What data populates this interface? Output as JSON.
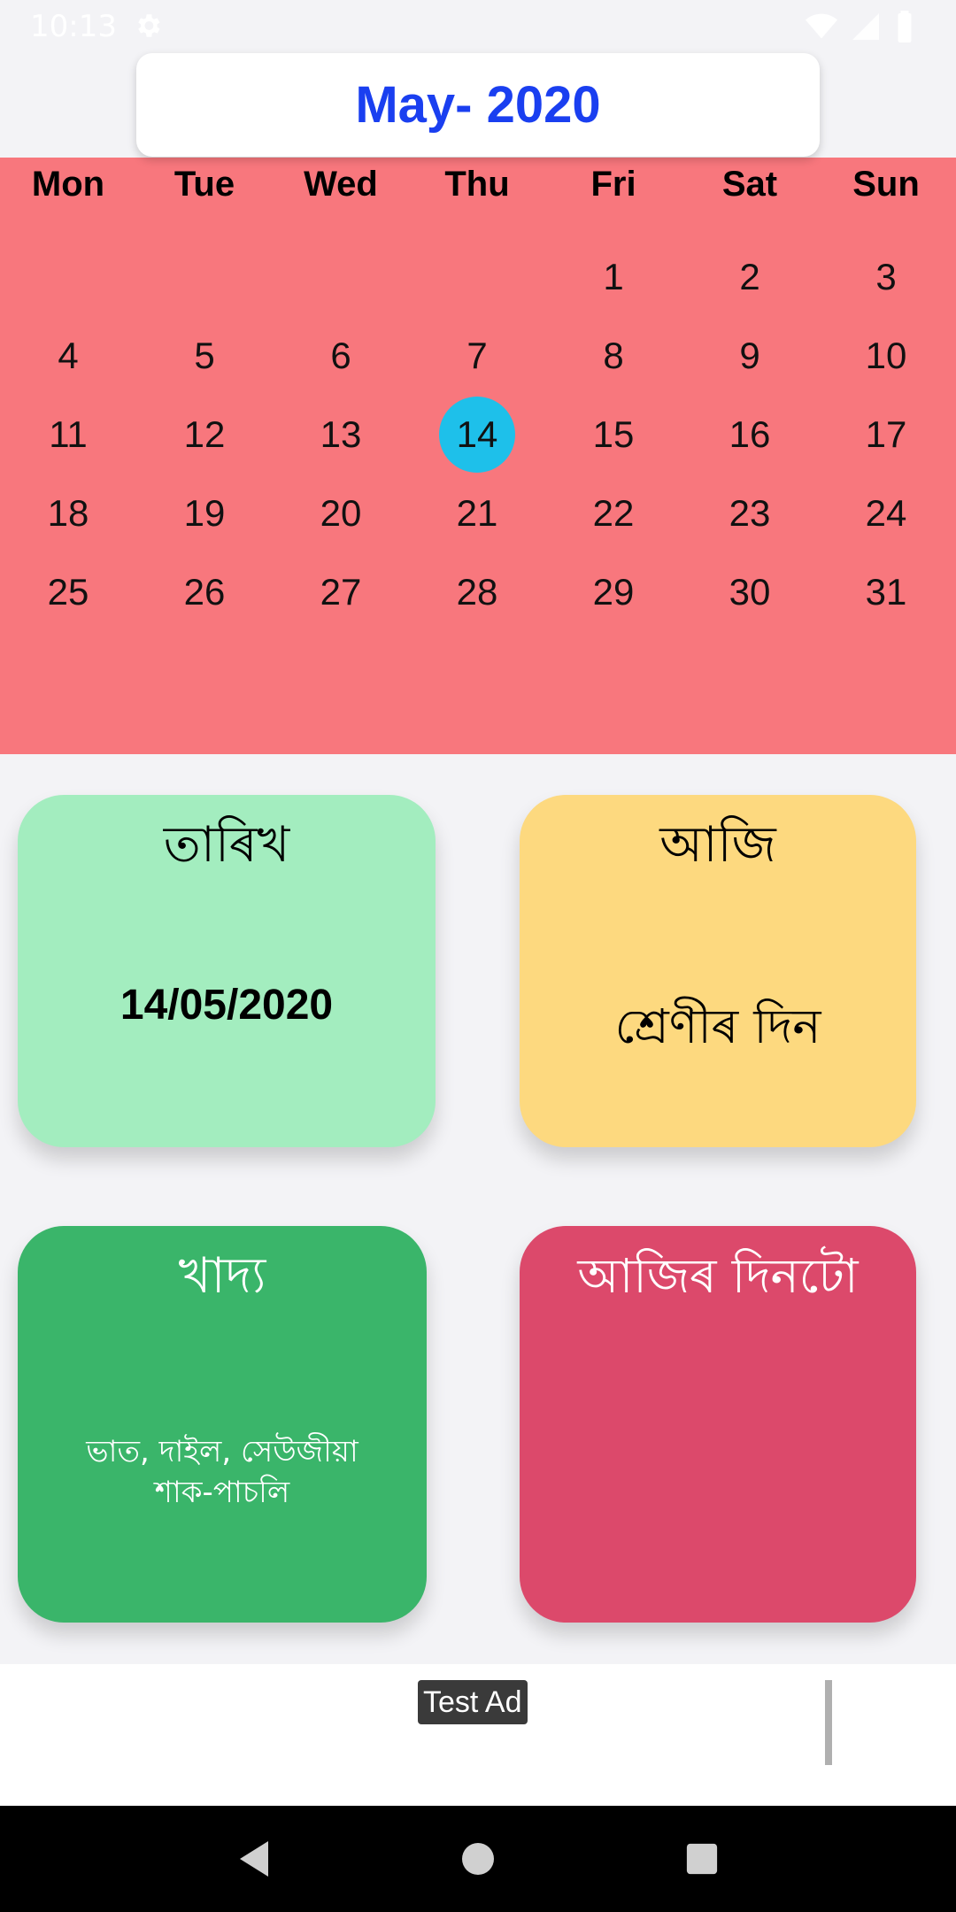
{
  "status_bar": {
    "time": "10:13",
    "icons": [
      "settings-gear-icon",
      "wifi-icon",
      "signal-icon",
      "battery-icon"
    ]
  },
  "header": {
    "month_title": "May- 2020"
  },
  "calendar": {
    "weekdays": [
      "Mon",
      "Tue",
      "Wed",
      "Thu",
      "Fri",
      "Sat",
      "Sun"
    ],
    "days": [
      "",
      "",
      "",
      "",
      "1",
      "2",
      "3",
      "4",
      "5",
      "6",
      "7",
      "8",
      "9",
      "10",
      "11",
      "12",
      "13",
      "14",
      "15",
      "16",
      "17",
      "18",
      "19",
      "20",
      "21",
      "22",
      "23",
      "24",
      "25",
      "26",
      "27",
      "28",
      "29",
      "30",
      "31"
    ],
    "selected_day": "14"
  },
  "cards": {
    "date": {
      "title": "তাৰিখ",
      "value": "14/05/2020"
    },
    "today": {
      "title": "আজি",
      "value": "শ্ৰেণীৰ দিন"
    },
    "food": {
      "title": "খাদ্য",
      "value": "ভাত, দাইল, সেউজীয়া শাক-পাচলি"
    },
    "day_type": {
      "title": "আজিৰ দিনটো"
    }
  },
  "ad": {
    "label": "Test Ad"
  },
  "nav": {
    "icons": [
      "back-icon",
      "home-icon",
      "recents-icon"
    ]
  },
  "colors": {
    "calendar_bg": "#f8777d",
    "selected_day": "#1ec0ea",
    "month_title": "#1a3ff0",
    "card_date": "#a3edbf",
    "card_today": "#fdd97f",
    "card_food": "#3ab56a",
    "card_day_type": "#dc496b"
  }
}
